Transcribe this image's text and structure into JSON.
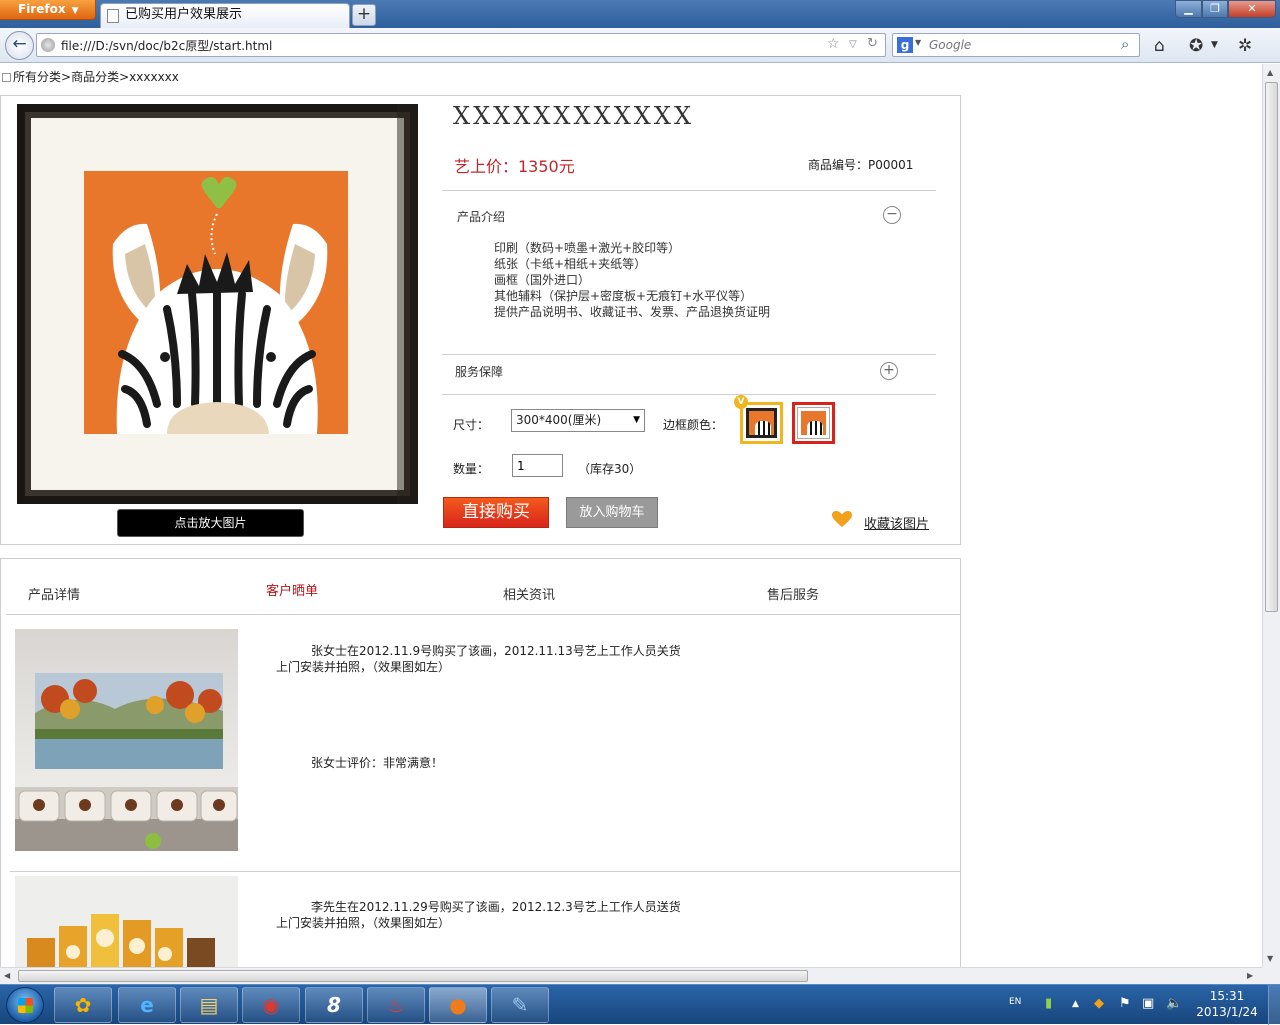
{
  "browser": {
    "app_button": "Firefox",
    "tab_title": "已购买用户效果展示",
    "url": "file:///D:/svn/doc/b2c原型/start.html",
    "search_placeholder": "Google"
  },
  "breadcrumb": {
    "items": [
      "所有分类",
      "商品分类",
      "xxxxxxx"
    ],
    "separator": ">"
  },
  "product": {
    "title": "XXXXXXXXXXXX",
    "price": "艺上价：1350元",
    "sku": "商品编号：P00001",
    "zoom_button": "点击放大图片",
    "intro": {
      "header": "产品介绍",
      "collapse_symbol": "−",
      "items": [
        "印刷（数码+喷墨+激光+胶印等）",
        "纸张（卡纸+相纸+夹纸等）",
        "画框（国外进口）",
        "其他辅料（保护层+密度板+无痕钉+水平仪等）",
        "提供产品说明书、收藏证书、发票、产品退换货证明"
      ]
    },
    "service": {
      "header": "服务保障",
      "expand_symbol": "+"
    },
    "options": {
      "size_label": "尺寸：",
      "size_value": "300*400(厘米)",
      "frame_label": "边框颜色：",
      "selected_badge": "V",
      "qty_label": "数量：",
      "qty_value": "1",
      "stock": "（库存30）"
    },
    "buy_now": "直接购买",
    "add_to_cart": "放入购物车",
    "favorite": "收藏该图片"
  },
  "tabs": [
    "产品详情",
    "客户晒单",
    "相关资讯",
    "售后服务"
  ],
  "reviews": [
    {
      "line1": "张女士在2012.11.9号购买了该画，2012.11.13号艺上工作人员关货",
      "line2": "上门安装并拍照，（效果图如左）",
      "rating": "张女士评价：非常满意！"
    },
    {
      "line1": "李先生在2012.11.29号购买了该画，2012.12.3号艺上工作人员送货",
      "line2": "上门安装并拍照，（效果图如左）"
    }
  ],
  "taskbar": {
    "lang": "EN",
    "time": "15:31",
    "date": "2013/1/24"
  },
  "colors": {
    "price_red": "#c0262b",
    "active_tab": "#b5161b",
    "buy_button": "#e33a1b",
    "frame_gold": "#f1b61e",
    "frame_red": "#d8221b",
    "painting_orange": "#e8762b"
  }
}
